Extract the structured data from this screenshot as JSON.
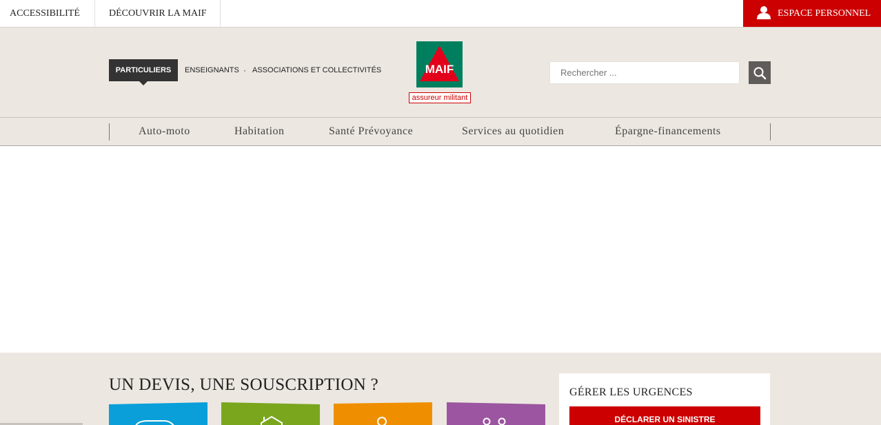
{
  "topbar": {
    "accessibility": "ACCESSIBILITÉ",
    "discover": "DÉCOUVRIR LA MAIF",
    "espace": "ESPACE PERSONNEL"
  },
  "header": {
    "segments": [
      "PARTICULIERS",
      "ENSEIGNANTS",
      "·",
      "ASSOCIATIONS ET COLLECTIVITÉS"
    ],
    "logo_text": "MAIF",
    "logo_tagline": "assureur militant",
    "search_placeholder": "Rechercher ..."
  },
  "nav": {
    "items": [
      "Auto-moto",
      "Habitation",
      "Santé Prévoyance",
      "Services au quotidien",
      "Épargne-financements"
    ]
  },
  "bottom": {
    "devis_title": "UN DEVIS, UNE SOUSCRIPTION ?",
    "tiles": [
      {
        "icon": "car-icon",
        "color": "#0a9fd8"
      },
      {
        "icon": "house-icon",
        "color": "#7aa61e"
      },
      {
        "icon": "person-icon",
        "color": "#ef8f00"
      },
      {
        "icon": "family-icon",
        "color": "#9c55a0"
      }
    ],
    "urgences_title": "GÉRER LES URGENCES",
    "declare_button": "DÉCLARER UN SINISTRE"
  },
  "colors": {
    "accent_red": "#cc0000",
    "header_bg": "#ece7e1",
    "logo_green": "#007f5f"
  }
}
